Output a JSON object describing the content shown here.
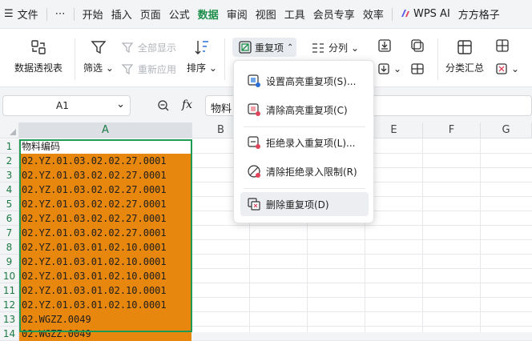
{
  "menubar": {
    "hamburger": "☰",
    "file": "文件",
    "more": "⋯",
    "tabs": [
      "开始",
      "插入",
      "页面",
      "公式",
      "数据",
      "审阅",
      "视图",
      "工具",
      "会员专享",
      "效率"
    ],
    "active_tab": "数据",
    "wps_ai": "WPS AI",
    "fangfang": "方方格子"
  },
  "ribbon": {
    "pivot": "数据透视表",
    "filter": "筛选",
    "show_all": "全部显示",
    "reapply": "重新应用",
    "sort": "排序",
    "duplicates": "重复项",
    "split": "分列",
    "subtotal": "分类汇总"
  },
  "formula": {
    "cell_ref": "A1",
    "fx": "fx",
    "content": "物料"
  },
  "columns": [
    "A",
    "B",
    "C",
    "D",
    "E",
    "F",
    "G"
  ],
  "rows": [
    {
      "n": "1",
      "a": "物料编码"
    },
    {
      "n": "2",
      "a": "02.YZ.01.03.02.02.27.0001"
    },
    {
      "n": "3",
      "a": "02.YZ.01.03.02.02.27.0001"
    },
    {
      "n": "4",
      "a": "02.YZ.01.03.02.02.27.0001"
    },
    {
      "n": "5",
      "a": "02.YZ.01.03.02.02.27.0001"
    },
    {
      "n": "6",
      "a": "02.YZ.01.03.02.02.27.0001"
    },
    {
      "n": "7",
      "a": "02.YZ.01.03.02.02.27.0001"
    },
    {
      "n": "8",
      "a": "02.YZ.01.03.01.02.10.0001"
    },
    {
      "n": "9",
      "a": "02.YZ.01.03.01.02.10.0001"
    },
    {
      "n": "10",
      "a": "02.YZ.01.03.01.02.10.0001"
    },
    {
      "n": "11",
      "a": "02.YZ.01.03.01.02.10.0001"
    },
    {
      "n": "12",
      "a": "02.YZ.01.03.01.02.10.0001"
    },
    {
      "n": "13",
      "a": "02.WGZZ.0049"
    },
    {
      "n": "14",
      "a": "02.WGZZ.0049"
    }
  ],
  "dropdown": {
    "items": [
      "设置高亮重复项(S)...",
      "清除高亮重复项(C)",
      "拒绝录入重复项(L)...",
      "清除拒绝录入限制(R)",
      "删除重复项(D)"
    ]
  },
  "colors": {
    "accent": "#1f8f4c",
    "fill": "#e8870e",
    "selection": "#1f9a55"
  },
  "icons": [
    "pivot-table-icon",
    "filter-icon",
    "show-all-icon",
    "reapply-icon",
    "sort-icon",
    "duplicates-icon",
    "split-column-icon",
    "subtotal-icon",
    "zoom-icon",
    "fx-icon"
  ]
}
